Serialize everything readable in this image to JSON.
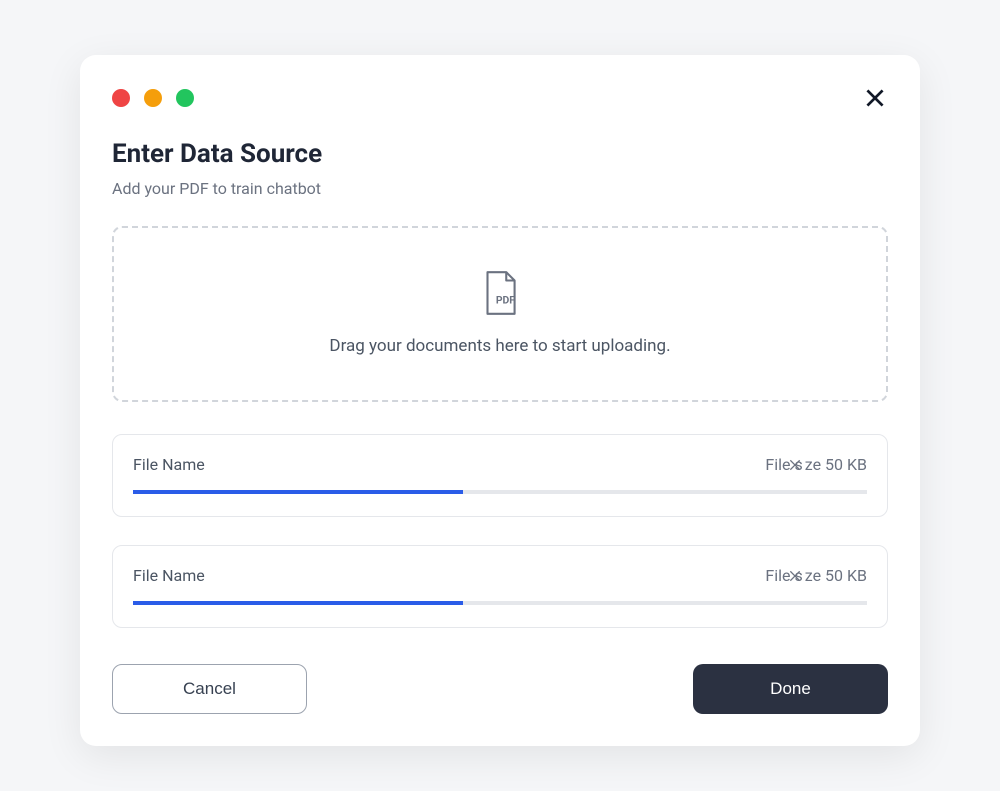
{
  "header": {
    "title": "Enter Data Source",
    "subtitle": "Add your PDF to train chatbot"
  },
  "dropzone": {
    "hint": "Drag your documents here to start uploading.",
    "icon_label": "PDF"
  },
  "files": [
    {
      "name": "File Name",
      "size_prefix": "File s",
      "size_suffix": "ze 50 KB",
      "progress_percent": 45
    },
    {
      "name": "File Name",
      "size_prefix": "File s",
      "size_suffix": "ze 50 KB",
      "progress_percent": 45
    }
  ],
  "footer": {
    "cancel_label": "Cancel",
    "done_label": "Done"
  },
  "colors": {
    "accent": "#2a5ce8",
    "done_bg": "#2b3141",
    "traffic_red": "#ef4444",
    "traffic_yellow": "#f59e0b",
    "traffic_green": "#22c55e"
  }
}
